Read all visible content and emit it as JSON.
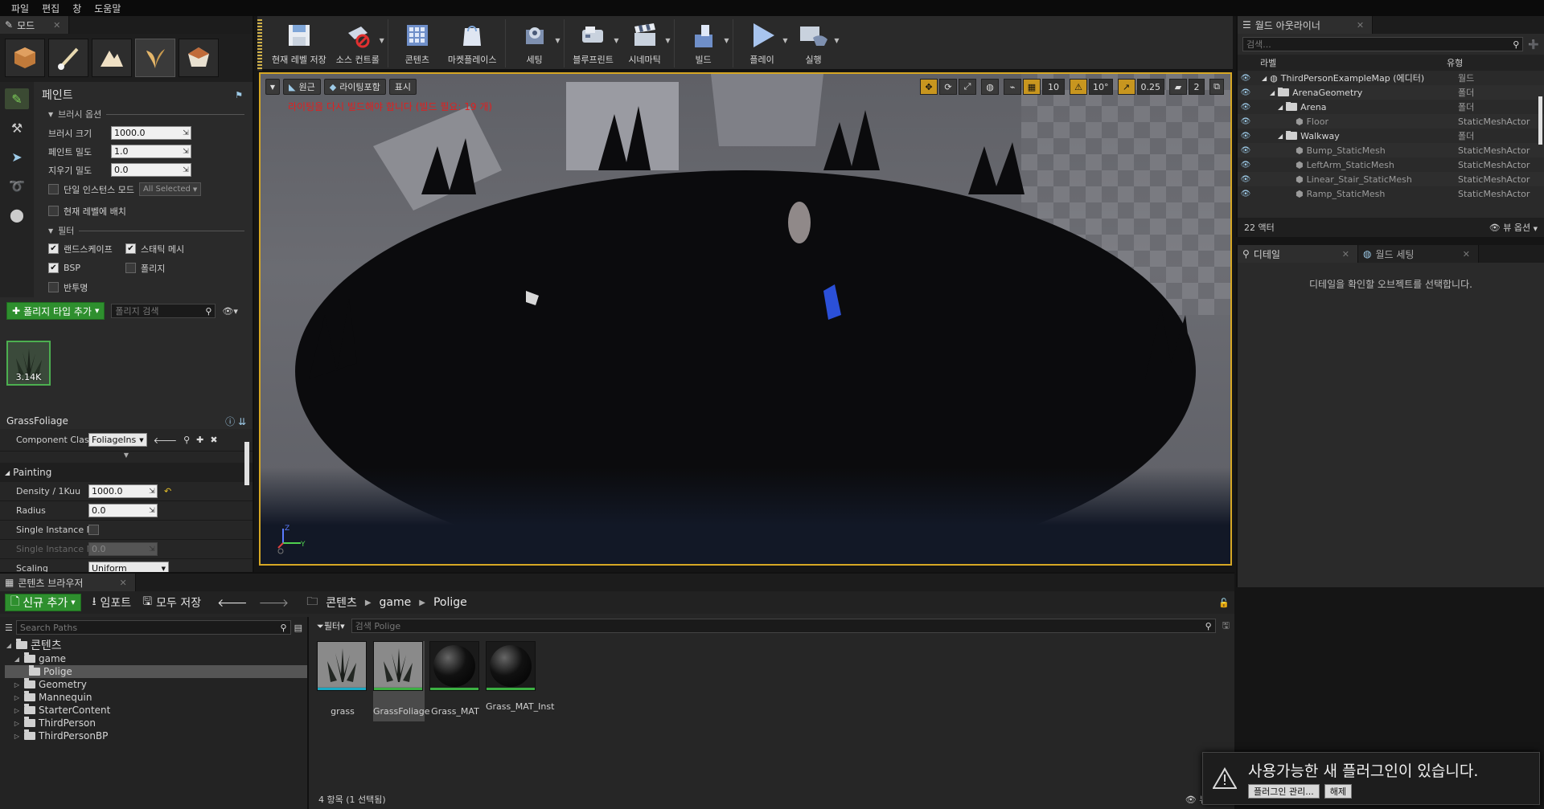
{
  "menu": [
    "파일",
    "편집",
    "창",
    "도움말"
  ],
  "modes_panel": {
    "tab": "모드",
    "mode_icons": [
      "place-mode-icon",
      "paint-mode-icon",
      "landscape-mode-icon",
      "foliage-mode-icon",
      "geometry-mode-icon"
    ],
    "paint_title": "페인트",
    "brush_section": "브러시 옵션",
    "brush_size_label": "브러시 크기",
    "brush_size": "1000.0",
    "paint_density_label": "페인트 밀도",
    "paint_density": "1.0",
    "erase_density_label": "지우기 밀도",
    "erase_density": "0.0",
    "single_instance_label": "단일 인스턴스 모드",
    "single_instance_combo": "All Selected",
    "place_current_level_label": "현재 레벨에 배치",
    "filter_section": "필터",
    "filters": [
      {
        "label": "랜드스케이프",
        "checked": true
      },
      {
        "label": "스태틱 메시",
        "checked": true
      },
      {
        "label": "BSP",
        "checked": true
      },
      {
        "label": "폴리지",
        "checked": false
      },
      {
        "label": "반투명",
        "checked": false
      }
    ],
    "add_foliage_type": "폴리지 타입 추가",
    "foliage_search_placeholder": "폴리지 검색",
    "foliage_count": "3.14K"
  },
  "grass_foliage": {
    "title": "GrassFoliage",
    "component_class_label": "Component Class",
    "component_class_value": "FoliageIns",
    "painting_section": "Painting",
    "density_label": "Density / 1Kuu",
    "density_value": "1000.0",
    "radius_label": "Radius",
    "radius_value": "0.0",
    "single_instance_label": "Single Instance M",
    "single_instance_value_label": "Single Instance M",
    "single_instance_value": "0.0",
    "scaling_label": "Scaling",
    "scaling_value": "Uniform"
  },
  "toolbar": [
    {
      "id": "save-level",
      "label": "현재 레벨 저장",
      "icon": "save-icon",
      "dd": false
    },
    {
      "id": "source-control",
      "label": "소스 컨트롤",
      "icon": "source-control-icon",
      "dd": true
    },
    {
      "id": "content",
      "label": "콘텐츠",
      "icon": "content-icon",
      "dd": false
    },
    {
      "id": "marketplace",
      "label": "마켓플레이스",
      "icon": "marketplace-icon",
      "dd": false
    },
    {
      "id": "settings",
      "label": "세팅",
      "icon": "gear-icon",
      "dd": true
    },
    {
      "id": "blueprint",
      "label": "블루프린트",
      "icon": "blueprint-icon",
      "dd": true
    },
    {
      "id": "cinematics",
      "label": "시네마틱",
      "icon": "clapper-icon",
      "dd": true
    },
    {
      "id": "build",
      "label": "빌드",
      "icon": "build-icon",
      "dd": true
    },
    {
      "id": "play",
      "label": "플레이",
      "icon": "play-icon",
      "dd": true
    },
    {
      "id": "launch",
      "label": "실행",
      "icon": "launch-icon",
      "dd": true
    }
  ],
  "viewport": {
    "perspective": "원근",
    "lighting": "라이팅포함",
    "show": "표시",
    "warning": "라이팅을 다시 빌드해야 합니다 (빌드 필요: 19 개)",
    "grid_snap": "10",
    "rotation_snap": "10°",
    "scale_snap": "0.25",
    "camera_speed": "2"
  },
  "outliner": {
    "tab": "월드 아웃라이너",
    "search_placeholder": "검색...",
    "col_label": "라벨",
    "col_type": "유형",
    "rows": [
      {
        "name": "ThirdPersonExampleMap (에디터)",
        "type": "월드",
        "indent": 1,
        "kind": "world"
      },
      {
        "name": "ArenaGeometry",
        "type": "폴더",
        "indent": 2,
        "kind": "folder"
      },
      {
        "name": "Arena",
        "type": "폴더",
        "indent": 3,
        "kind": "folder"
      },
      {
        "name": "Floor",
        "type": "StaticMeshActor",
        "indent": 4,
        "kind": "actor"
      },
      {
        "name": "Walkway",
        "type": "폴더",
        "indent": 3,
        "kind": "folder"
      },
      {
        "name": "Bump_StaticMesh",
        "type": "StaticMeshActor",
        "indent": 4,
        "kind": "actor"
      },
      {
        "name": "LeftArm_StaticMesh",
        "type": "StaticMeshActor",
        "indent": 4,
        "kind": "actor"
      },
      {
        "name": "Linear_Stair_StaticMesh",
        "type": "StaticMeshActor",
        "indent": 4,
        "kind": "actor"
      },
      {
        "name": "Ramp_StaticMesh",
        "type": "StaticMeshActor",
        "indent": 4,
        "kind": "actor"
      }
    ],
    "actor_count": "22 액터",
    "view_options": "뷰 옵션"
  },
  "details": {
    "tab_details": "디테일",
    "tab_world_settings": "월드 세팅",
    "empty_message": "디테일을 확인할 오브젝트를 선택합니다."
  },
  "content_browser": {
    "tab": "콘텐츠 브라우저",
    "add_new": "신규 추가",
    "import": "임포트",
    "save_all": "모두 저장",
    "path": [
      "콘텐츠",
      "game",
      "Polige"
    ],
    "search_paths_placeholder": "Search Paths",
    "filter_label": "필터",
    "search_assets_placeholder": "검색 Polige",
    "tree": [
      {
        "name": "콘텐츠",
        "indent": 0,
        "open": true,
        "selected": false
      },
      {
        "name": "game",
        "indent": 1,
        "open": true,
        "selected": false
      },
      {
        "name": "Polige",
        "indent": 2,
        "open": false,
        "selected": true
      },
      {
        "name": "Geometry",
        "indent": 1,
        "open": false,
        "selected": false
      },
      {
        "name": "Mannequin",
        "indent": 1,
        "open": false,
        "selected": false
      },
      {
        "name": "StarterContent",
        "indent": 1,
        "open": false,
        "selected": false
      },
      {
        "name": "ThirdPerson",
        "indent": 1,
        "open": false,
        "selected": false
      },
      {
        "name": "ThirdPersonBP",
        "indent": 1,
        "open": false,
        "selected": false
      }
    ],
    "assets": [
      {
        "name": "grass",
        "kind": "grass",
        "underline": "#1aa9c4",
        "selected": false
      },
      {
        "name": "GrassFoliage",
        "kind": "grass",
        "underline": "#3cb043",
        "selected": true
      },
      {
        "name": "Grass_MAT",
        "kind": "material",
        "underline": "#3cb043",
        "selected": false
      },
      {
        "name": "Grass_MAT_Inst",
        "kind": "material",
        "underline": "#3cb043",
        "selected": false
      }
    ],
    "status": "4 항목 (1 선택됨)",
    "view_options": "뷰 옵"
  },
  "plugin_toast": {
    "title": "사용가능한 새 플러그인이 있습니다.",
    "manage": "플러그인 관리...",
    "dismiss": "해제"
  },
  "colors": {
    "accent_green": "#2e8f2e",
    "viewport_border": "#d6a724",
    "warning_red": "#e02020"
  }
}
